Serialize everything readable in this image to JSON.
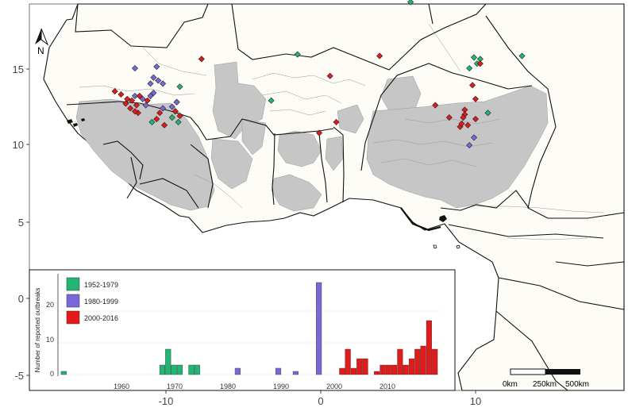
{
  "map": {
    "y_axis_ticks": [
      "15",
      "10",
      "5",
      "0",
      "-5"
    ],
    "x_axis_ticks": [
      "-10",
      "0",
      "10"
    ],
    "north_label": "N",
    "scale_bar": {
      "labels": [
        "0km",
        "250km",
        "500km"
      ]
    },
    "colors": {
      "ocean": "#ffffff",
      "land": "#fdfcf6",
      "affected": "#c6c6c6",
      "border": "#111111",
      "admin": "#8a8a8a",
      "period_1": "#22b573",
      "period_2": "#7b68d8",
      "period_3": "#e21a1a"
    },
    "markers": {
      "period_1": [
        [
          -9.1,
          8.8
        ],
        [
          -9.3,
          7.8
        ],
        [
          -9.6,
          6.8
        ],
        [
          -9.2,
          6.5
        ],
        [
          -10.9,
          6.5
        ],
        [
          -1.5,
          10.9
        ],
        [
          -3.2,
          7.9
        ],
        [
          6.2,
          15.5
        ],
        [
          5.8,
          14.3
        ],
        [
          9.9,
          10.7
        ],
        [
          10.1,
          10.3
        ],
        [
          10.3,
          10.6
        ],
        [
          9.6,
          10.0
        ],
        [
          13.0,
          10.8
        ],
        [
          10.8,
          7.1
        ]
      ],
      "period_2": [
        [
          -12.0,
          10.0
        ],
        [
          -10.6,
          10.1
        ],
        [
          -10.8,
          9.4
        ],
        [
          -11.0,
          9.0
        ],
        [
          -10.5,
          9.2
        ],
        [
          -10.2,
          9.0
        ],
        [
          -10.8,
          8.4
        ],
        [
          -11.0,
          8.2
        ],
        [
          -12.0,
          8.2
        ],
        [
          -11.5,
          8.0
        ],
        [
          -11.3,
          7.6
        ],
        [
          -10.2,
          7.4
        ],
        [
          -9.3,
          7.8
        ],
        [
          -9.6,
          7.5
        ],
        [
          9.6,
          5.0
        ],
        [
          9.9,
          5.5
        ]
      ],
      "period_3": [
        [
          -13.3,
          8.5
        ],
        [
          -12.9,
          8.3
        ],
        [
          -12.5,
          8.0
        ],
        [
          -12.2,
          7.9
        ],
        [
          -11.9,
          7.6
        ],
        [
          -12.3,
          7.4
        ],
        [
          -11.8,
          7.1
        ],
        [
          -12.6,
          7.7
        ],
        [
          -12.0,
          7.2
        ],
        [
          -11.2,
          7.9
        ],
        [
          -11.7,
          8.2
        ],
        [
          -10.4,
          7.1
        ],
        [
          -10.6,
          6.7
        ],
        [
          -10.1,
          6.3
        ],
        [
          -9.4,
          7.2
        ],
        [
          -9.1,
          6.9
        ],
        [
          -7.7,
          10.6
        ],
        [
          0.6,
          9.5
        ],
        [
          1.0,
          6.5
        ],
        [
          -0.1,
          5.8
        ],
        [
          3.8,
          10.8
        ],
        [
          10.3,
          10.3
        ],
        [
          9.8,
          8.9
        ],
        [
          10.0,
          8.0
        ],
        [
          7.4,
          7.6
        ],
        [
          9.3,
          7.3
        ],
        [
          9.3,
          7.0
        ],
        [
          9.2,
          6.8
        ],
        [
          9.5,
          6.3
        ],
        [
          9.0,
          6.2
        ],
        [
          9.1,
          6.4
        ],
        [
          10.0,
          6.7
        ],
        [
          8.3,
          6.8
        ]
      ]
    }
  },
  "inset": {
    "legend": [
      {
        "label": "1952-1979",
        "color": "#22b573"
      },
      {
        "label": "1980-1999",
        "color": "#7b68d8"
      },
      {
        "label": "2000-2016",
        "color": "#e21a1a"
      }
    ],
    "ylabel": "Number of reported outbreaks",
    "y_ticks": [
      "0",
      "10",
      "20"
    ],
    "x_ticks": [
      "1960",
      "1970",
      "1980",
      "1990",
      "2000",
      "2010"
    ]
  },
  "chart_data": {
    "type": "bar",
    "ylabel": "Number of reported outbreaks",
    "xlim": [
      1951,
      2017
    ],
    "ylim": [
      0,
      29
    ],
    "series": [
      {
        "name": "1952-1979",
        "x": [
          1952,
          1969,
          1970,
          1971,
          1972,
          1974,
          1975
        ],
        "values": [
          1,
          3,
          8,
          3,
          3,
          3,
          3
        ]
      },
      {
        "name": "1980-1999",
        "x": [
          1982,
          1989,
          1992,
          1996
        ],
        "values": [
          2,
          2,
          1,
          29
        ]
      },
      {
        "name": "2000-2016",
        "x": [
          2000,
          2001,
          2002,
          2003,
          2004,
          2005,
          2006,
          2007,
          2008,
          2009,
          2010,
          2011,
          2012,
          2013,
          2014,
          2015,
          2016
        ],
        "values": [
          2,
          8,
          2,
          5,
          5,
          0,
          1,
          3,
          3,
          3,
          8,
          3,
          5,
          8,
          9,
          17,
          8
        ]
      }
    ]
  }
}
